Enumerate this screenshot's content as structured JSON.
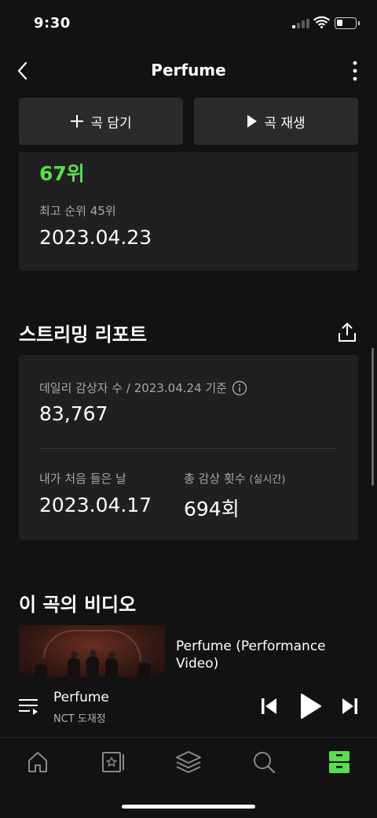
{
  "status_bar": {
    "time": "9:30"
  },
  "header": {
    "title": "Perfume"
  },
  "actions": {
    "add_label": "곡 담기",
    "play_label": "곡 재생"
  },
  "rank": {
    "current": "67위",
    "best_label": "최고 순위 45위",
    "best_date": "2023.04.23"
  },
  "report": {
    "title": "스트리밍 리포트",
    "daily_label": "데일리 감상자 수 / 2023.04.24 기준",
    "daily_value": "83,767",
    "first_listen_label": "내가 처음 들은 날",
    "first_listen_value": "2023.04.17",
    "total_label": "총 감상 횟수",
    "total_label_suffix": "(실시간)",
    "total_value": "694회"
  },
  "video": {
    "section_title": "이 곡의 비디오",
    "name": "Perfume (Performance Video)"
  },
  "now_playing": {
    "title": "Perfume",
    "artist": "NCT 도재정"
  },
  "colors": {
    "accent": "#59de4e",
    "background": "#121212",
    "card": "#202020",
    "button": "#2b2b2b"
  },
  "icons": {
    "nav": [
      "home-icon",
      "storage-icon",
      "layers-icon",
      "search-icon",
      "drawer-icon"
    ]
  }
}
